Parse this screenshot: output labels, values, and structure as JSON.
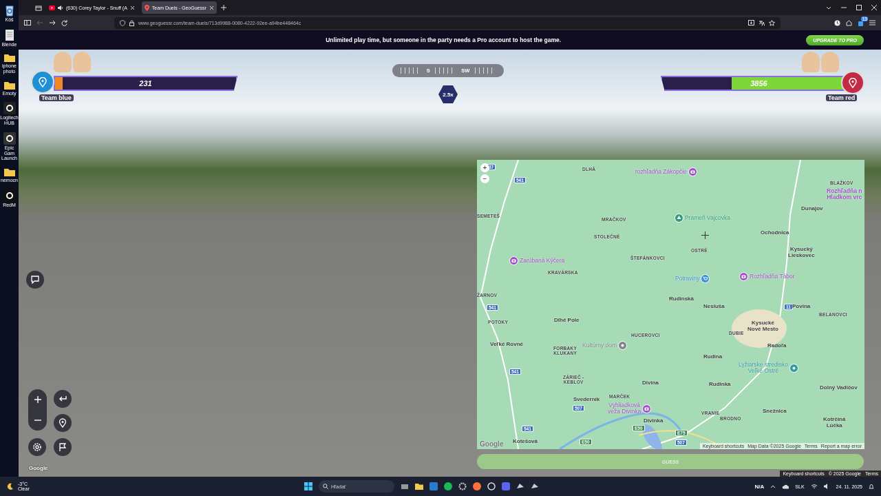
{
  "desktop": {
    "icons": [
      {
        "label": "Kôš"
      },
      {
        "label": "Blende"
      },
      {
        "label": "iphone photo"
      },
      {
        "label": "Emoty"
      },
      {
        "label": "Logitech HUB"
      },
      {
        "label": "Epic Gam Launch"
      },
      {
        "label": "nemocn"
      },
      {
        "label": "RedM"
      }
    ]
  },
  "browser": {
    "tabs": [
      {
        "title": "(630) Corey Taylor - Snuff (A",
        "selected": false,
        "audio": true
      },
      {
        "title": "Team Duels - GeoGuessr",
        "selected": true,
        "audio": false
      }
    ],
    "url": "www.geoguessr.com/team-duels/713d9988-0080-4222-92ee-a94be448464c",
    "extension_badge": "13"
  },
  "banner": {
    "text": "Unlimited play time, but someone in the party needs a Pro account to host the game.",
    "button": "UPGRADE TO PRO"
  },
  "game": {
    "teams": [
      {
        "name": "Team blue",
        "score": "231",
        "level": 0.04,
        "color": "#1f8fd6"
      },
      {
        "name": "Team red",
        "score": "3856",
        "level": 0.64,
        "color": "#c42a45"
      }
    ],
    "compass": [
      "S",
      "SW"
    ],
    "zoom": "2.5x",
    "street_view_attribution": {
      "logo": "Google",
      "links": [
        "Keyboard shortcuts",
        "© 2025 Google",
        "Terms"
      ]
    },
    "map": {
      "labels": [
        {
          "kind": "shield",
          "text": "37",
          "color": "#3b6fc1"
        },
        {
          "kind": "shield",
          "text": "541",
          "color": "#3b6fc1"
        },
        {
          "kind": "hamlet",
          "text": "DLHÁ"
        },
        {
          "kind": "poi",
          "text": "rozhľadňa Zákopčie",
          "color": "#a24fc8"
        },
        {
          "kind": "hamlet",
          "text": "BLAŽKOV"
        },
        {
          "kind": "poi",
          "text": "Rozhľadňa n\nHladkom vrc",
          "color": "#a24fc8"
        },
        {
          "kind": "town",
          "text": "Dunajov"
        },
        {
          "kind": "hamlet",
          "text": "SEMETEŠ"
        },
        {
          "kind": "hamlet",
          "text": "MRAČKOV"
        },
        {
          "kind": "poi",
          "text": "Prameň Vajcovka",
          "color": "#2f9c7c"
        },
        {
          "kind": "hamlet",
          "text": "STOLEČNÉ"
        },
        {
          "kind": "town",
          "text": "Ochodnica"
        },
        {
          "kind": "hamlet",
          "text": "OSTRÉ"
        },
        {
          "kind": "town",
          "text": "Kysucký\nLieskovec"
        },
        {
          "kind": "hamlet",
          "text": "ŠTEFÁNKOVCI"
        },
        {
          "kind": "poi",
          "text": "Zarúbaná Kýčera",
          "color": "#a24fc8"
        },
        {
          "kind": "hamlet",
          "text": "KRAVÁRSKA"
        },
        {
          "kind": "poi",
          "text": "Potraviny",
          "color": "#3a8fd8"
        },
        {
          "kind": "poi",
          "text": "Rozhľadňa Tábor",
          "color": "#a24fc8"
        },
        {
          "kind": "hamlet",
          "text": "ŽARNOV"
        },
        {
          "kind": "shield",
          "text": "541",
          "color": "#3b6fc1"
        },
        {
          "kind": "town",
          "text": "Rudinská"
        },
        {
          "kind": "town",
          "text": "Nesluša"
        },
        {
          "kind": "shield",
          "text": "11",
          "color": "#3b6fc1"
        },
        {
          "kind": "town",
          "text": "Povina"
        },
        {
          "kind": "hamlet",
          "text": "BELANOVCI"
        },
        {
          "kind": "hamlet",
          "text": "POTOKY"
        },
        {
          "kind": "town",
          "text": "Dlhé Pole"
        },
        {
          "kind": "hamlet",
          "text": "HUCEROVCI"
        },
        {
          "kind": "town",
          "text": "Kysucké\nNové Mesto"
        },
        {
          "kind": "hamlet",
          "text": "DUBIE"
        },
        {
          "kind": "town",
          "text": "Veľké Rovné"
        },
        {
          "kind": "hamlet",
          "text": "FORBAKY\nKLUKANY"
        },
        {
          "kind": "poi",
          "text": "Kultúrny dom",
          "color": "#80868b"
        },
        {
          "kind": "town",
          "text": "Radoľa"
        },
        {
          "kind": "town",
          "text": "Rudina"
        },
        {
          "kind": "shield",
          "text": "541",
          "color": "#3b6fc1"
        },
        {
          "kind": "poi",
          "text": "Lyžiarske stredisko\nVeľké Ostré",
          "color": "#2f9ca0"
        },
        {
          "kind": "hamlet",
          "text": "ZÁRIEČ -\nKEBLOV"
        },
        {
          "kind": "town",
          "text": "Divina"
        },
        {
          "kind": "town",
          "text": "Rudinka"
        },
        {
          "kind": "town",
          "text": "Dolný Vadičov"
        },
        {
          "kind": "town",
          "text": "Svederník"
        },
        {
          "kind": "hamlet",
          "text": "MARČEK"
        },
        {
          "kind": "shield",
          "text": "507",
          "color": "#3b6fc1"
        },
        {
          "kind": "poi",
          "text": "Vyhliadková\nveža Divinka",
          "color": "#a24fc8"
        },
        {
          "kind": "town",
          "text": "Snežnica"
        },
        {
          "kind": "hamlet",
          "text": "VRANIE"
        },
        {
          "kind": "hamlet",
          "text": "BRODNO"
        },
        {
          "kind": "town",
          "text": "Divinka"
        },
        {
          "kind": "town",
          "text": "Kotrčiná\nLúčka"
        },
        {
          "kind": "shield",
          "text": "E50",
          "color": "#3d8a4f"
        },
        {
          "kind": "shield",
          "text": "E75",
          "color": "#3d8a4f"
        },
        {
          "kind": "shield",
          "text": "541",
          "color": "#3b6fc1"
        },
        {
          "kind": "town",
          "text": "Kotešová"
        },
        {
          "kind": "shield",
          "text": "E50",
          "color": "#3d8a4f"
        },
        {
          "kind": "shield",
          "text": "507",
          "color": "#3b6fc1"
        }
      ],
      "zoom_buttons": [
        "+",
        "−"
      ],
      "attribution": {
        "logo": "Google",
        "links": [
          "Keyboard shortcuts",
          "Map Data ©2025 Google",
          "Terms",
          "Report a map error"
        ]
      }
    },
    "guess": {
      "label": "GUESS",
      "disabled": true
    }
  },
  "taskbar": {
    "temperature": "-3°C",
    "weather": "Clear",
    "search_placeholder": "Hľadať",
    "widget": "N/A",
    "language": "SLK",
    "date": "24. 11. 2025"
  }
}
